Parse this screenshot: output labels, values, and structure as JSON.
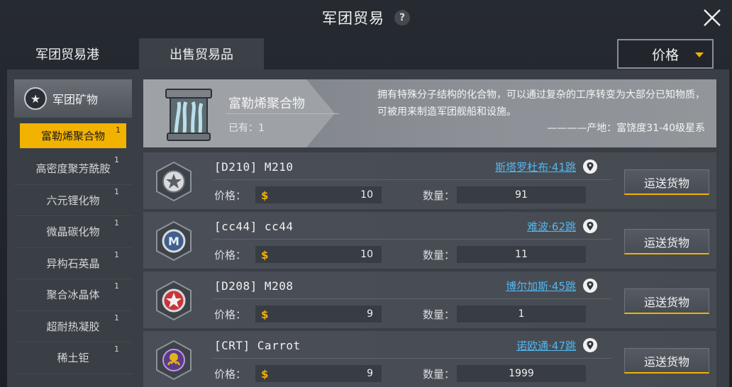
{
  "header": {
    "title": "军团贸易",
    "help": "?"
  },
  "tabs": [
    {
      "label": "军团贸易港"
    },
    {
      "label": "出售贸易品"
    }
  ],
  "sort": {
    "label": "价格"
  },
  "sidebar": {
    "category": "军团矿物",
    "items": [
      {
        "label": "富勒烯聚合物",
        "count": "1"
      },
      {
        "label": "高密度聚芳酰胺",
        "count": "1"
      },
      {
        "label": "六元锂化物",
        "count": "1"
      },
      {
        "label": "微晶碳化物",
        "count": "1"
      },
      {
        "label": "异构石英晶",
        "count": "1"
      },
      {
        "label": "聚合冰晶体",
        "count": "1"
      },
      {
        "label": "超耐热凝胶",
        "count": "1"
      },
      {
        "label": "稀土钜",
        "count": "1"
      }
    ]
  },
  "banner": {
    "name": "富勒烯聚合物",
    "owned": "已有：1",
    "description": "拥有特殊分子结构的化合物，可以通过复杂的工序转变为大部分已知物质，可被用来制造军团舰船和设施。",
    "origin": "————产地：富饶度31-40级星系"
  },
  "labels": {
    "price": "价格：",
    "qty": "数量：",
    "ship": "运送货物"
  },
  "trades": [
    {
      "name": "[D210]  M210",
      "route": "斯塔罗杜布·41跳",
      "price": "10",
      "qty": "91",
      "emblem": "star-silver"
    },
    {
      "name": "[cc44]  cc44",
      "route": "难波·62跳",
      "price": "10",
      "qty": "11",
      "emblem": "letter-m"
    },
    {
      "name": "[D208]  M208",
      "route": "博尔加斯·45跳",
      "price": "9",
      "qty": "1",
      "emblem": "star-red"
    },
    {
      "name": "[CRT]  Carrot",
      "route": "诺欧通·47跳",
      "price": "9",
      "qty": "1999",
      "emblem": "octopus"
    }
  ],
  "colors": {
    "accent": "#f2b200",
    "link": "#52b7ef"
  }
}
